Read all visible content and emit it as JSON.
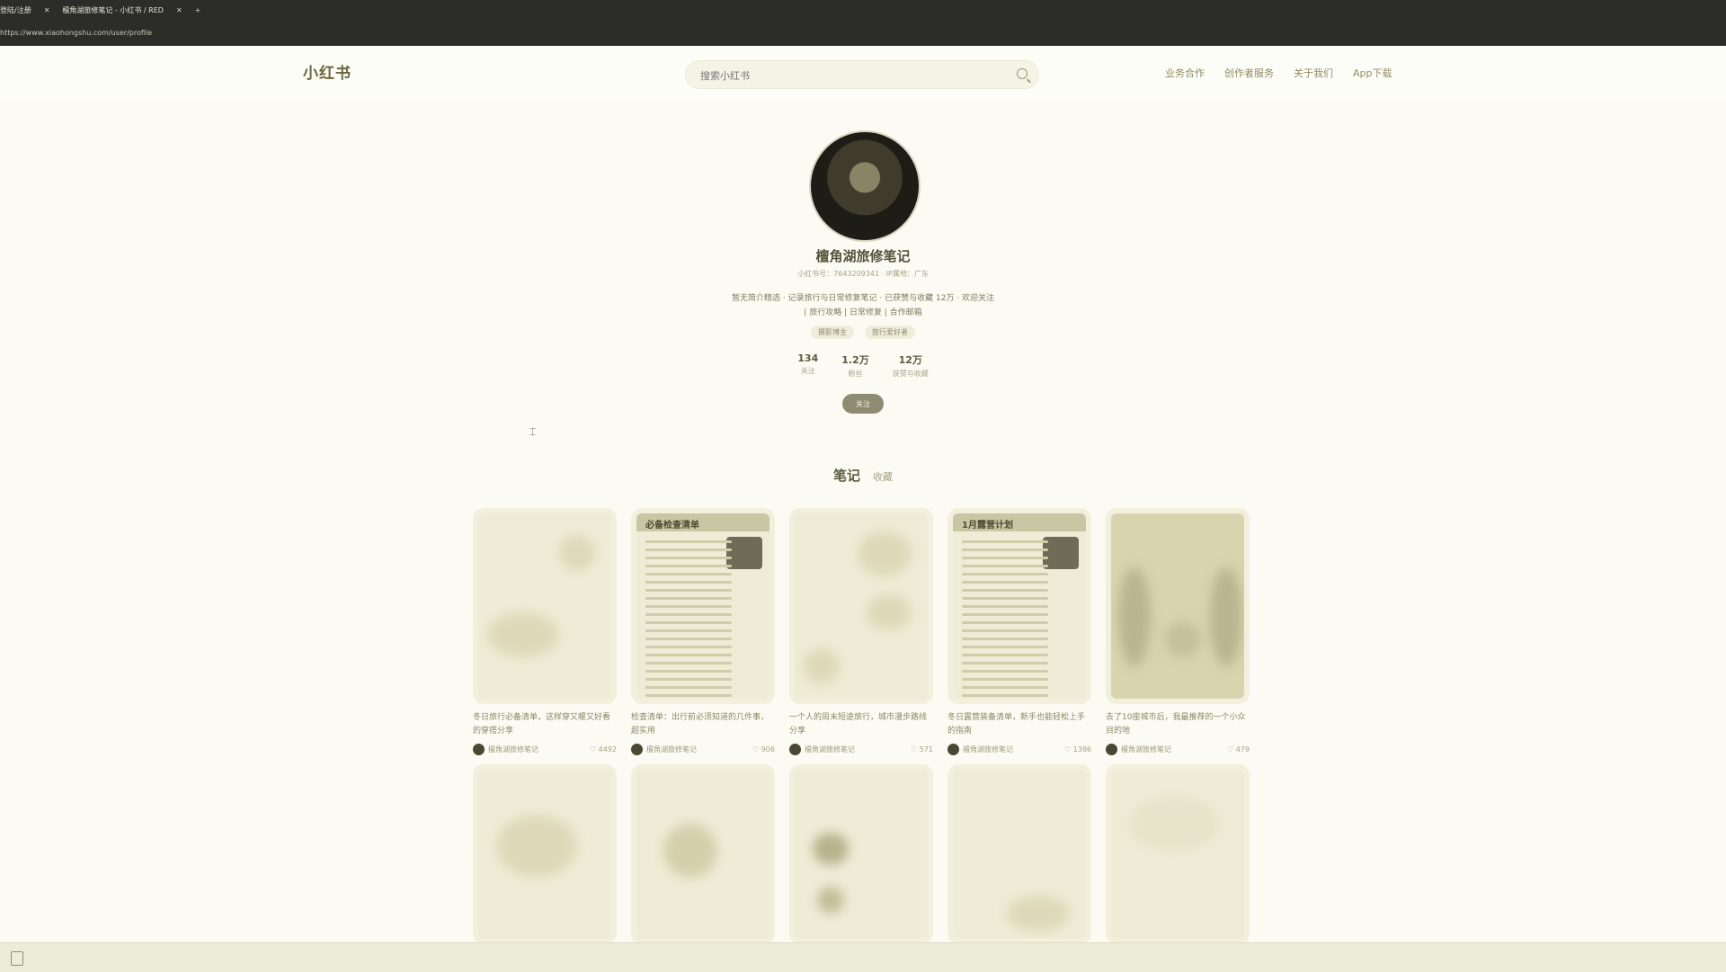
{
  "browser": {
    "tab_label": "登陆/注册",
    "tab_close": "✕",
    "active_tab": "檀角湖旅修笔记 - 小红书 / RED",
    "active_tab_close": "✕",
    "new_tab": "+",
    "address": "https://www.xiaohongshu.com/user/profile"
  },
  "header": {
    "logo": "小红书",
    "search_placeholder": "搜索小红书",
    "nav": [
      "业务合作",
      "创作者服务",
      "关于我们",
      "App下载"
    ]
  },
  "profile": {
    "name": "檀角湖旅修笔记",
    "meta": "小红书号：7643209341 · IP属地：广东",
    "bio_line1": "暂无简介精选 · 记录旅行与日常修复笔记 · 已获赞与收藏 12万 · 欢迎关注",
    "bio_line2": "| 旅行攻略 | 日常修复 | 合作邮箱",
    "tags": [
      "摄影博主",
      "旅行爱好者"
    ],
    "stats": [
      {
        "value": "134",
        "label": "关注"
      },
      {
        "value": "1.2万",
        "label": "粉丝"
      },
      {
        "value": "12万",
        "label": "获赞与收藏"
      }
    ],
    "follow_label": "关注"
  },
  "tabs": {
    "notes": "笔记",
    "collect": "收藏"
  },
  "cards": [
    {
      "title": "冬日旅行必备清单，这样穿又暖又好看的穿搭分享",
      "author": "檀角湖旅修笔记",
      "likes": "4492",
      "header": ""
    },
    {
      "title": "检查清单：出行前必须知道的几件事，超实用",
      "author": "檀角湖旅修笔记",
      "likes": "906",
      "header": "必备检查清单"
    },
    {
      "title": "一个人的周末短途旅行，城市漫步路线分享",
      "author": "檀角湖旅修笔记",
      "likes": "571",
      "header": ""
    },
    {
      "title": "冬日露营装备清单，新手也能轻松上手的指南",
      "author": "檀角湖旅修笔记",
      "likes": "1386",
      "header": "1月露营计划"
    },
    {
      "title": "去了10座城市后，我最推荐的一个小众目的地",
      "author": "檀角湖旅修笔记",
      "likes": "479",
      "header": ""
    }
  ]
}
